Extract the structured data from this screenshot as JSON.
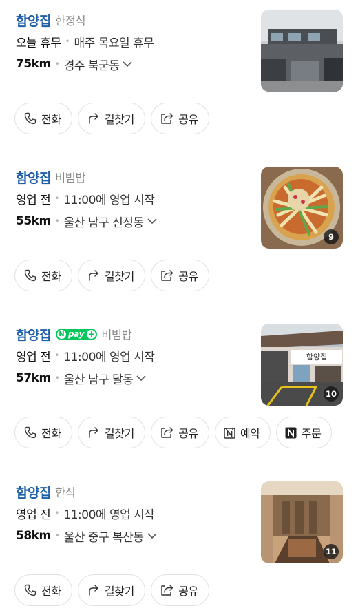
{
  "results": [
    {
      "name": "함양집",
      "category": "한정식",
      "npay": false,
      "status": "오늘 휴무",
      "status_detail": "매주 목요일 휴무",
      "distance": "75km",
      "address": "경주 북군동",
      "photo_count": "",
      "photo": "building-exterior",
      "actions": [
        "전화",
        "길찾기",
        "공유"
      ]
    },
    {
      "name": "함양집",
      "category": "비빔밥",
      "npay": false,
      "status": "영업 전",
      "status_detail": "11:00에 영업 시작",
      "distance": "55km",
      "address": "울산 남구 신정동",
      "photo_count": "9",
      "photo": "bibimbap-bowl",
      "actions": [
        "전화",
        "길찾기",
        "공유"
      ]
    },
    {
      "name": "함양집",
      "category": "비빔밥",
      "npay": true,
      "npay_label": "pay",
      "status": "영업 전",
      "status_detail": "11:00에 영업 시작",
      "distance": "57km",
      "address": "울산 남구 달동",
      "photo_count": "10",
      "photo": "restaurant-front",
      "sign_text": "함양집",
      "actions": [
        "전화",
        "길찾기",
        "공유",
        "예약",
        "주문"
      ]
    },
    {
      "name": "함양집",
      "category": "한식",
      "npay": false,
      "status": "영업 전",
      "status_detail": "11:00에 영업 시작",
      "distance": "58km",
      "address": "울산 중구 복산동",
      "photo_count": "11",
      "photo": "dining-room",
      "actions": [
        "전화",
        "길찾기",
        "공유"
      ]
    }
  ],
  "icons": {
    "전화": "phone-icon",
    "길찾기": "directions-icon",
    "공유": "share-icon",
    "예약": "naver-reservation-icon",
    "주문": "naver-order-icon"
  },
  "colors": {
    "name": "#1f5fa8",
    "npay": "#03c75a",
    "category": "#8a8a8a"
  }
}
